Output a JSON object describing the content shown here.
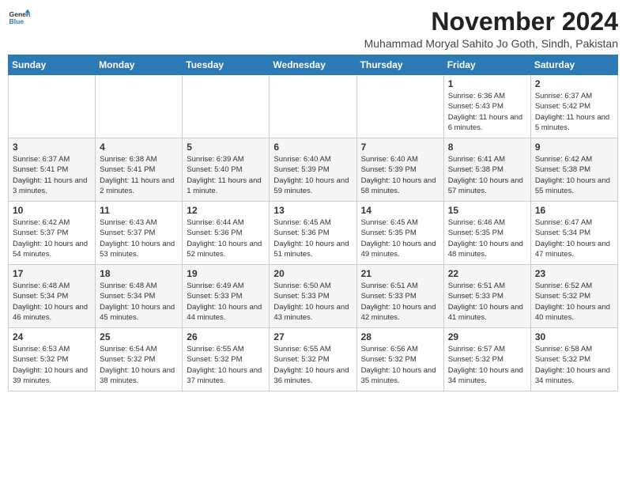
{
  "header": {
    "logo_line1": "General",
    "logo_line2": "Blue",
    "month": "November 2024",
    "location": "Muhammad Moryal Sahito Jo Goth, Sindh, Pakistan"
  },
  "weekdays": [
    "Sunday",
    "Monday",
    "Tuesday",
    "Wednesday",
    "Thursday",
    "Friday",
    "Saturday"
  ],
  "weeks": [
    [
      {
        "day": "",
        "info": ""
      },
      {
        "day": "",
        "info": ""
      },
      {
        "day": "",
        "info": ""
      },
      {
        "day": "",
        "info": ""
      },
      {
        "day": "",
        "info": ""
      },
      {
        "day": "1",
        "info": "Sunrise: 6:36 AM\nSunset: 5:43 PM\nDaylight: 11 hours and 6 minutes."
      },
      {
        "day": "2",
        "info": "Sunrise: 6:37 AM\nSunset: 5:42 PM\nDaylight: 11 hours and 5 minutes."
      }
    ],
    [
      {
        "day": "3",
        "info": "Sunrise: 6:37 AM\nSunset: 5:41 PM\nDaylight: 11 hours and 3 minutes."
      },
      {
        "day": "4",
        "info": "Sunrise: 6:38 AM\nSunset: 5:41 PM\nDaylight: 11 hours and 2 minutes."
      },
      {
        "day": "5",
        "info": "Sunrise: 6:39 AM\nSunset: 5:40 PM\nDaylight: 11 hours and 1 minute."
      },
      {
        "day": "6",
        "info": "Sunrise: 6:40 AM\nSunset: 5:39 PM\nDaylight: 10 hours and 59 minutes."
      },
      {
        "day": "7",
        "info": "Sunrise: 6:40 AM\nSunset: 5:39 PM\nDaylight: 10 hours and 58 minutes."
      },
      {
        "day": "8",
        "info": "Sunrise: 6:41 AM\nSunset: 5:38 PM\nDaylight: 10 hours and 57 minutes."
      },
      {
        "day": "9",
        "info": "Sunrise: 6:42 AM\nSunset: 5:38 PM\nDaylight: 10 hours and 55 minutes."
      }
    ],
    [
      {
        "day": "10",
        "info": "Sunrise: 6:42 AM\nSunset: 5:37 PM\nDaylight: 10 hours and 54 minutes."
      },
      {
        "day": "11",
        "info": "Sunrise: 6:43 AM\nSunset: 5:37 PM\nDaylight: 10 hours and 53 minutes."
      },
      {
        "day": "12",
        "info": "Sunrise: 6:44 AM\nSunset: 5:36 PM\nDaylight: 10 hours and 52 minutes."
      },
      {
        "day": "13",
        "info": "Sunrise: 6:45 AM\nSunset: 5:36 PM\nDaylight: 10 hours and 51 minutes."
      },
      {
        "day": "14",
        "info": "Sunrise: 6:45 AM\nSunset: 5:35 PM\nDaylight: 10 hours and 49 minutes."
      },
      {
        "day": "15",
        "info": "Sunrise: 6:46 AM\nSunset: 5:35 PM\nDaylight: 10 hours and 48 minutes."
      },
      {
        "day": "16",
        "info": "Sunrise: 6:47 AM\nSunset: 5:34 PM\nDaylight: 10 hours and 47 minutes."
      }
    ],
    [
      {
        "day": "17",
        "info": "Sunrise: 6:48 AM\nSunset: 5:34 PM\nDaylight: 10 hours and 46 minutes."
      },
      {
        "day": "18",
        "info": "Sunrise: 6:48 AM\nSunset: 5:34 PM\nDaylight: 10 hours and 45 minutes."
      },
      {
        "day": "19",
        "info": "Sunrise: 6:49 AM\nSunset: 5:33 PM\nDaylight: 10 hours and 44 minutes."
      },
      {
        "day": "20",
        "info": "Sunrise: 6:50 AM\nSunset: 5:33 PM\nDaylight: 10 hours and 43 minutes."
      },
      {
        "day": "21",
        "info": "Sunrise: 6:51 AM\nSunset: 5:33 PM\nDaylight: 10 hours and 42 minutes."
      },
      {
        "day": "22",
        "info": "Sunrise: 6:51 AM\nSunset: 5:33 PM\nDaylight: 10 hours and 41 minutes."
      },
      {
        "day": "23",
        "info": "Sunrise: 6:52 AM\nSunset: 5:32 PM\nDaylight: 10 hours and 40 minutes."
      }
    ],
    [
      {
        "day": "24",
        "info": "Sunrise: 6:53 AM\nSunset: 5:32 PM\nDaylight: 10 hours and 39 minutes."
      },
      {
        "day": "25",
        "info": "Sunrise: 6:54 AM\nSunset: 5:32 PM\nDaylight: 10 hours and 38 minutes."
      },
      {
        "day": "26",
        "info": "Sunrise: 6:55 AM\nSunset: 5:32 PM\nDaylight: 10 hours and 37 minutes."
      },
      {
        "day": "27",
        "info": "Sunrise: 6:55 AM\nSunset: 5:32 PM\nDaylight: 10 hours and 36 minutes."
      },
      {
        "day": "28",
        "info": "Sunrise: 6:56 AM\nSunset: 5:32 PM\nDaylight: 10 hours and 35 minutes."
      },
      {
        "day": "29",
        "info": "Sunrise: 6:57 AM\nSunset: 5:32 PM\nDaylight: 10 hours and 34 minutes."
      },
      {
        "day": "30",
        "info": "Sunrise: 6:58 AM\nSunset: 5:32 PM\nDaylight: 10 hours and 34 minutes."
      }
    ]
  ]
}
